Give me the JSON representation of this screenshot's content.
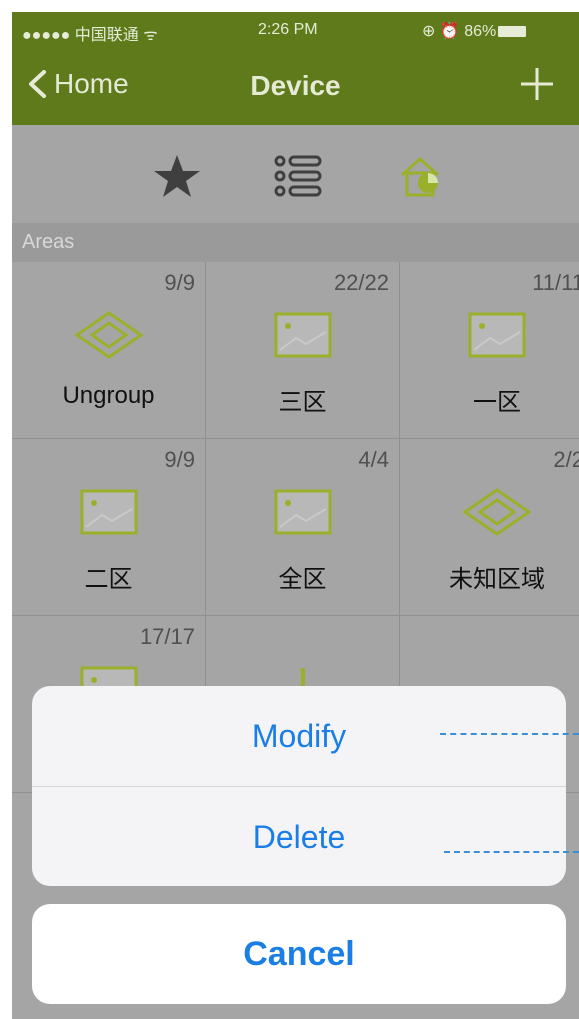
{
  "status_bar": {
    "carrier": "●●●●● 中国联通 ᯤ",
    "time": "2:26 PM",
    "right": "⊕ ⏰ 86%"
  },
  "nav": {
    "back_label": "Home",
    "title": "Device"
  },
  "toolbar": {
    "icons": [
      "star-icon",
      "list-icon",
      "home-pie-icon"
    ]
  },
  "section_header": "Areas",
  "areas": [
    {
      "count": "9/9",
      "name": "Ungroup",
      "icon": "diamond-icon"
    },
    {
      "count": "22/22",
      "name": "三区",
      "icon": "picture-icon"
    },
    {
      "count": "11/11",
      "name": "一区",
      "icon": "picture-icon"
    },
    {
      "count": "9/9",
      "name": "二区",
      "icon": "picture-icon"
    },
    {
      "count": "4/4",
      "name": "全区",
      "icon": "picture-icon"
    },
    {
      "count": "2/2",
      "name": "未知区域",
      "icon": "diamond-icon"
    },
    {
      "count": "17/17",
      "name": "",
      "icon": "picture-icon"
    },
    {
      "count": "",
      "name": "",
      "icon": "add-icon"
    }
  ],
  "action_sheet": {
    "modify_label": "Modify",
    "delete_label": "Delete",
    "cancel_label": "Cancel"
  },
  "colors": {
    "nav_green": "#5e7a1b",
    "icon_green": "#9bb02a",
    "action_blue": "#1a7ee6"
  }
}
